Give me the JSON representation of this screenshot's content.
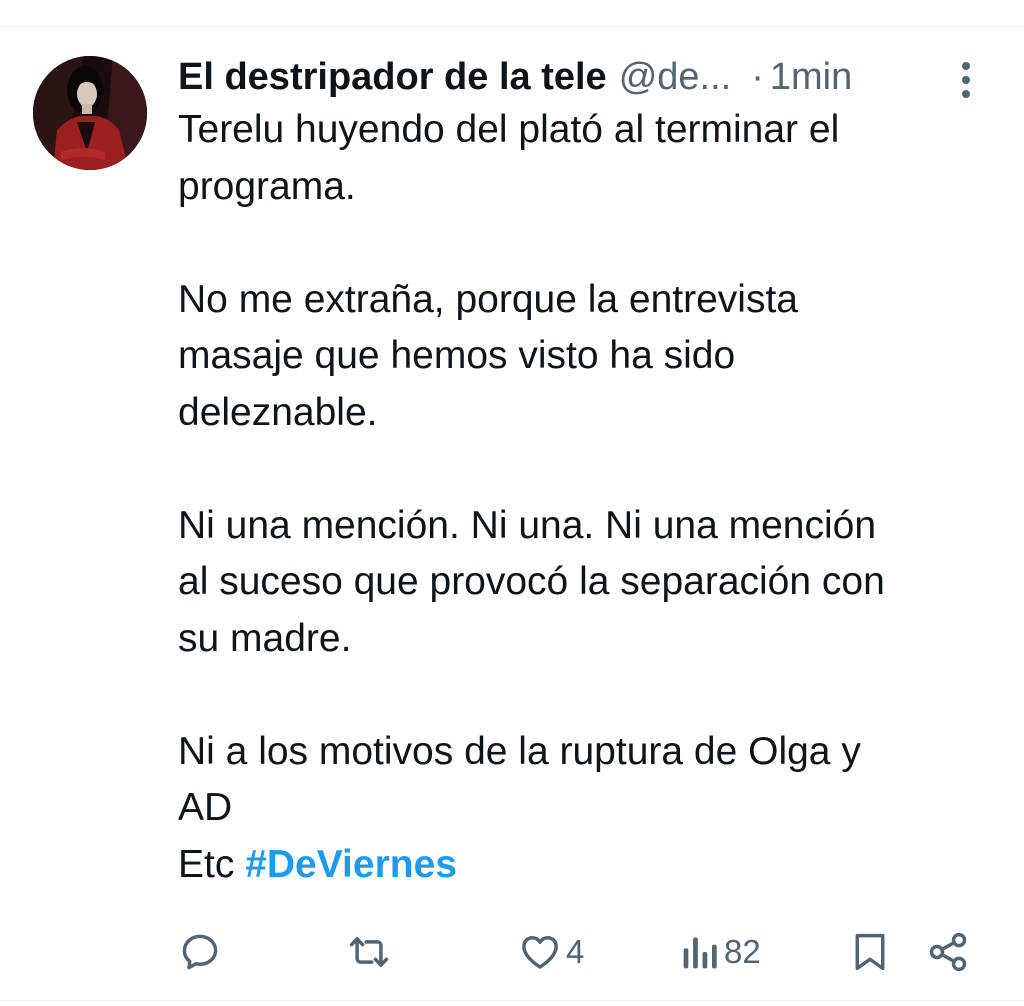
{
  "tweet": {
    "author": {
      "display_name": "El destripador de la tele",
      "handle": "@de...",
      "time": "1min"
    },
    "dot": "·",
    "text": {
      "p1_line1": "Terelu huyendo del plató al terminar el",
      "p1_line2": "programa.",
      "p2_line1": "No me extraña, porque la entrevista",
      "p2_line2": "masaje que hemos visto ha sido",
      "p2_line3": "deleznable.",
      "p3_line1": "Ni una mención. Ni una. Ni una mención",
      "p3_line2": "al suceso que provocó la separación con",
      "p3_line3": "su madre.",
      "p4_line1": "Ni a los motivos de la ruptura de Olga y",
      "p4_line2": "AD",
      "p4_line3_prefix": "Etc ",
      "hashtag": "#DeViernes"
    },
    "metrics": {
      "likes": "4",
      "views": "82"
    }
  },
  "icons": {
    "reply": "reply-icon",
    "retweet": "retweet-icon",
    "like": "heart-icon",
    "views": "views-chart-icon",
    "bookmark": "bookmark-icon",
    "share": "share-icon",
    "more": "more-vertical-icon"
  },
  "colors": {
    "text": "#0f1419",
    "secondary": "#536471",
    "hashtag": "#1d9bf0",
    "divider": "#eff3f4"
  }
}
